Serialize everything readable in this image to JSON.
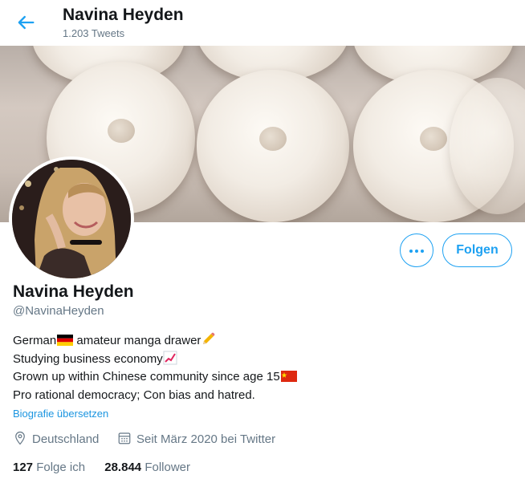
{
  "header": {
    "name": "Navina Heyden",
    "tweet_count": "1.203 Tweets"
  },
  "profile": {
    "name": "Navina Heyden",
    "handle": "@NavinaHeyden",
    "follow_label": "Folgen",
    "more_label": "More options",
    "bio": {
      "line1": "German",
      "line1b": " amateur manga drawer",
      "line2": "Studying business economy",
      "line3": "Grown up within Chinese community since age 15",
      "line4": "Pro rational democracy; Con bias and hatred."
    },
    "translate_label": "Biografie übersetzen",
    "location": "Deutschland",
    "joined": "Seit März 2020 bei Twitter",
    "following_count": "127",
    "following_label": "Folge ich",
    "followers_count": "28.844",
    "followers_label": "Follower"
  },
  "icons": {
    "back": "arrow-left-icon",
    "location": "location-pin-icon",
    "calendar": "calendar-icon",
    "more": "more-dots-icon"
  },
  "colors": {
    "accent": "#1da1f2",
    "secondary_text": "#657786",
    "primary_text": "#14171a"
  }
}
